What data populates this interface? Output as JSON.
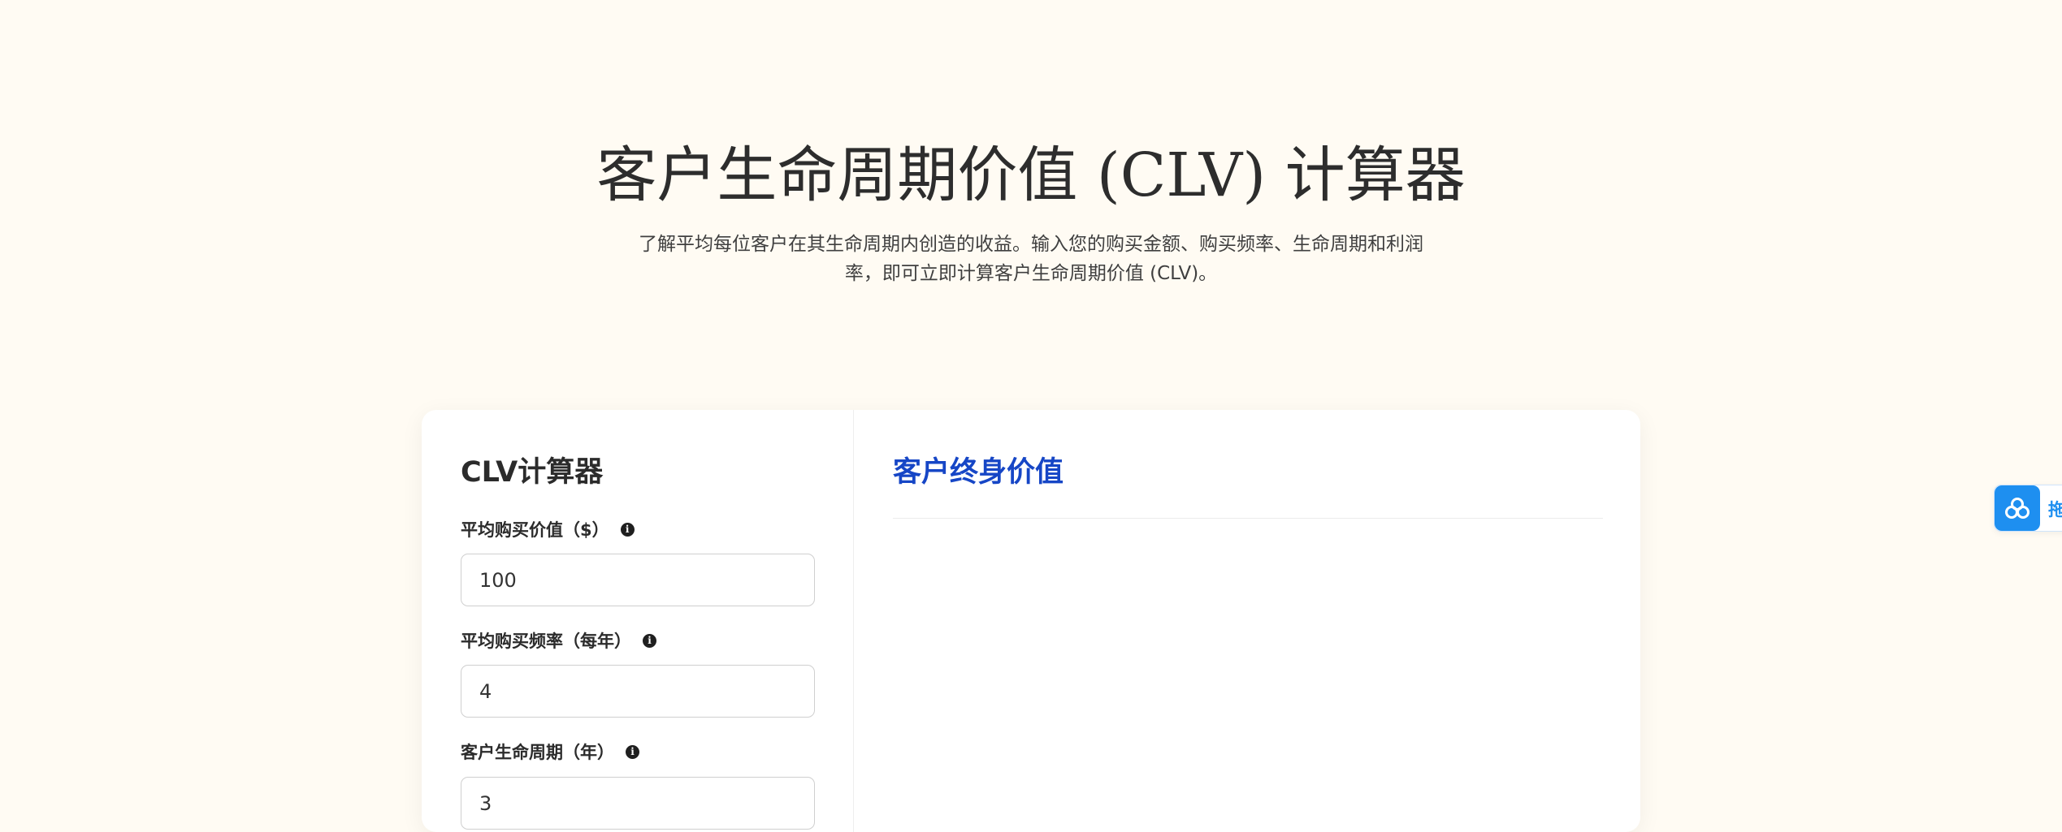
{
  "hero": {
    "title": "客户生命周期价值 (CLV) 计算器",
    "subtitle": "了解平均每位客户在其生命周期内创造的收益。输入您的购买金额、购买频率、生命周期和利润率，即可立即计算客户生命周期价值 (CLV)。"
  },
  "calculator": {
    "title": "CLV计算器",
    "fields": [
      {
        "label": "平均购买价值（$）",
        "value": "100"
      },
      {
        "label": "平均购买频率（每年）",
        "value": "4"
      },
      {
        "label": "客户生命周期（年）",
        "value": "3"
      }
    ]
  },
  "result": {
    "title": "客户终身价值"
  },
  "widget": {
    "icon": "link-rings-icon",
    "label": "拖"
  },
  "colors": {
    "background": "#fffbf3",
    "accent": "#1646c6",
    "widget": "#1e8ff0"
  }
}
